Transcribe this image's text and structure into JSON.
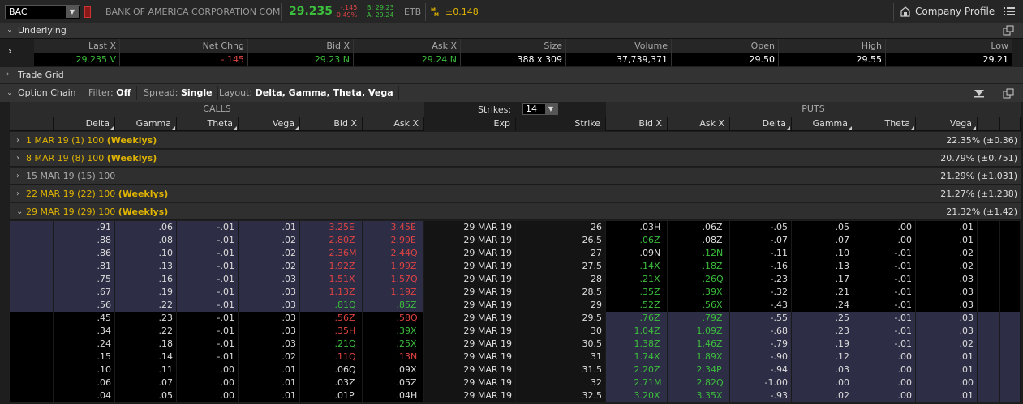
{
  "topbar": {
    "symbol": "BAC",
    "company": "BANK OF AMERICA CORPORATION COM",
    "last": "29.235",
    "net_change": "-.145",
    "pct_change": "-0.49%",
    "bid": "B: 29.23",
    "ask": "A: 29.24",
    "etb": "ETB",
    "mm_value": "±0.148",
    "company_profile": "Company Profile"
  },
  "underlying": {
    "title": "Underlying",
    "columns": [
      "Last X",
      "Net Chng",
      "Bid X",
      "Ask X",
      "Size",
      "Volume",
      "Open",
      "High",
      "Low"
    ],
    "values": [
      {
        "v": "29.235 V",
        "c": "green"
      },
      {
        "v": "-.145",
        "c": "red"
      },
      {
        "v": "29.23 N",
        "c": "green"
      },
      {
        "v": "29.24 N",
        "c": "green"
      },
      {
        "v": "388 x 309",
        "c": "white"
      },
      {
        "v": "37,739,371",
        "c": "white"
      },
      {
        "v": "29.50",
        "c": "white"
      },
      {
        "v": "29.55",
        "c": "white"
      },
      {
        "v": "29.21",
        "c": "white"
      }
    ]
  },
  "trade_grid": {
    "title": "Trade Grid"
  },
  "option_chain": {
    "title": "Option Chain",
    "filter_label": "Filter:",
    "filter_value": "Off",
    "spread_label": "Spread:",
    "spread_value": "Single",
    "layout_label": "Layout:",
    "layout_value": "Delta, Gamma, Theta, Vega",
    "calls_label": "CALLS",
    "puts_label": "PUTS",
    "strikes_label": "Strikes:",
    "strikes_value": "14",
    "call_headers": [
      "Delta",
      "Gamma",
      "Theta",
      "Vega",
      "Bid X",
      "Ask X"
    ],
    "mid_headers": [
      "Exp",
      "Strike"
    ],
    "put_headers": [
      "Bid X",
      "Ask X",
      "Delta",
      "Gamma",
      "Theta",
      "Vega"
    ]
  },
  "expirations": [
    {
      "date": "1 MAR 19",
      "days": "(1)",
      "mult": "100",
      "tag": "(Weeklys)",
      "iv": "22.35% (±0.36)",
      "color": "yellow",
      "expanded": false
    },
    {
      "date": "8 MAR 19",
      "days": "(8)",
      "mult": "100",
      "tag": "(Weeklys)",
      "iv": "20.79% (±0.751)",
      "color": "yellow",
      "expanded": false
    },
    {
      "date": "15 MAR 19",
      "days": "(15)",
      "mult": "100",
      "tag": "",
      "iv": "21.29% (±1.031)",
      "color": "grey",
      "expanded": false
    },
    {
      "date": "22 MAR 19",
      "days": "(22)",
      "mult": "100",
      "tag": "(Weeklys)",
      "iv": "21.27% (±1.238)",
      "color": "yellow",
      "expanded": false
    },
    {
      "date": "29 MAR 19",
      "days": "(29)",
      "mult": "100",
      "tag": "(Weeklys)",
      "iv": "21.32% (±1.42)",
      "color": "yellow",
      "expanded": true
    }
  ],
  "chain_rows": [
    {
      "cd": ".91",
      "cg": ".06",
      "ct": "-.01",
      "cv": ".01",
      "cb": "3.25",
      "cbx": "E",
      "ca": "3.45",
      "cax": "E",
      "exp": "29 MAR 19",
      "k": "26",
      "pb": ".03",
      "pbx": "H",
      "pa": ".06",
      "pax": "Z",
      "pd": "-.05",
      "pg": ".05",
      "pt": ".00",
      "pv": ".01",
      "itm": "call"
    },
    {
      "cd": ".88",
      "cg": ".08",
      "ct": "-.01",
      "cv": ".02",
      "cb": "2.80",
      "cbx": "Z",
      "ca": "2.99",
      "cax": "E",
      "exp": "29 MAR 19",
      "k": "26.5",
      "pb": ".06",
      "pbx": "Z",
      "pa": ".08",
      "pax": "Z",
      "pd": "-.07",
      "pg": ".07",
      "pt": ".00",
      "pv": ".01",
      "itm": "call"
    },
    {
      "cd": ".86",
      "cg": ".10",
      "ct": "-.01",
      "cv": ".02",
      "cb": "2.36",
      "cbx": "M",
      "ca": "2.44",
      "cax": "Q",
      "exp": "29 MAR 19",
      "k": "27",
      "pb": ".09",
      "pbx": "N",
      "pa": ".12",
      "pax": "N",
      "pd": "-.11",
      "pg": ".10",
      "pt": "-.01",
      "pv": ".02",
      "itm": "call"
    },
    {
      "cd": ".81",
      "cg": ".13",
      "ct": "-.01",
      "cv": ".02",
      "cb": "1.92",
      "cbx": "Z",
      "ca": "1.99",
      "cax": "Z",
      "exp": "29 MAR 19",
      "k": "27.5",
      "pb": ".14",
      "pbx": "X",
      "pa": ".18",
      "pax": "Z",
      "pd": "-.16",
      "pg": ".13",
      "pt": "-.01",
      "pv": ".02",
      "itm": "call"
    },
    {
      "cd": ".75",
      "cg": ".16",
      "ct": "-.01",
      "cv": ".03",
      "cb": "1.51",
      "cbx": "X",
      "ca": "1.57",
      "cax": "Q",
      "exp": "29 MAR 19",
      "k": "28",
      "pb": ".21",
      "pbx": "X",
      "pa": ".26",
      "pax": "Q",
      "pd": "-.23",
      "pg": ".17",
      "pt": "-.01",
      "pv": ".03",
      "itm": "call"
    },
    {
      "cd": ".67",
      "cg": ".19",
      "ct": "-.01",
      "cv": ".03",
      "cb": "1.13",
      "cbx": "Z",
      "ca": "1.19",
      "cax": "Z",
      "exp": "29 MAR 19",
      "k": "28.5",
      "pb": ".35",
      "pbx": "Z",
      "pa": ".39",
      "pax": "X",
      "pd": "-.32",
      "pg": ".21",
      "pt": "-.01",
      "pv": ".03",
      "itm": "call"
    },
    {
      "cd": ".56",
      "cg": ".22",
      "ct": "-.01",
      "cv": ".03",
      "cb": ".81",
      "cbx": "Q",
      "ca": ".85",
      "cax": "Z",
      "exp": "29 MAR 19",
      "k": "29",
      "pb": ".52",
      "pbx": "Z",
      "pa": ".56",
      "pax": "X",
      "pd": "-.43",
      "pg": ".24",
      "pt": "-.01",
      "pv": ".03",
      "itm": "call"
    },
    {
      "cd": ".45",
      "cg": ".23",
      "ct": "-.01",
      "cv": ".03",
      "cb": ".56",
      "cbx": "Z",
      "ca": ".58",
      "cax": "Q",
      "exp": "29 MAR 19",
      "k": "29.5",
      "pb": ".76",
      "pbx": "Z",
      "pa": ".79",
      "pax": "Z",
      "pd": "-.55",
      "pg": ".25",
      "pt": "-.01",
      "pv": ".03",
      "itm": "put"
    },
    {
      "cd": ".34",
      "cg": ".22",
      "ct": "-.01",
      "cv": ".03",
      "cb": ".35",
      "cbx": "H",
      "ca": ".39",
      "cax": "X",
      "exp": "29 MAR 19",
      "k": "30",
      "pb": "1.04",
      "pbx": "Z",
      "pa": "1.09",
      "pax": "Z",
      "pd": "-.68",
      "pg": ".23",
      "pt": "-.01",
      "pv": ".03",
      "itm": "put"
    },
    {
      "cd": ".24",
      "cg": ".18",
      "ct": "-.01",
      "cv": ".03",
      "cb": ".21",
      "cbx": "Q",
      "ca": ".25",
      "cax": "X",
      "exp": "29 MAR 19",
      "k": "30.5",
      "pb": "1.38",
      "pbx": "Z",
      "pa": "1.46",
      "pax": "Z",
      "pd": "-.79",
      "pg": ".19",
      "pt": "-.01",
      "pv": ".02",
      "itm": "put"
    },
    {
      "cd": ".15",
      "cg": ".14",
      "ct": "-.01",
      "cv": ".02",
      "cb": ".11",
      "cbx": "Q",
      "ca": ".13",
      "cax": "N",
      "exp": "29 MAR 19",
      "k": "31",
      "pb": "1.74",
      "pbx": "X",
      "pa": "1.89",
      "pax": "X",
      "pd": "-.90",
      "pg": ".12",
      "pt": ".00",
      "pv": ".01",
      "itm": "put"
    },
    {
      "cd": ".10",
      "cg": ".11",
      "ct": ".00",
      "cv": ".01",
      "cb": ".06",
      "cbx": "Q",
      "ca": ".09",
      "cax": "X",
      "exp": "29 MAR 19",
      "k": "31.5",
      "pb": "2.20",
      "pbx": "Z",
      "pa": "2.34",
      "pax": "P",
      "pd": "-.94",
      "pg": ".03",
      "pt": ".00",
      "pv": ".01",
      "itm": "put"
    },
    {
      "cd": ".06",
      "cg": ".07",
      "ct": ".00",
      "cv": ".01",
      "cb": ".03",
      "cbx": "Z",
      "ca": ".05",
      "cax": "Z",
      "exp": "29 MAR 19",
      "k": "32",
      "pb": "2.71",
      "pbx": "M",
      "pa": "2.82",
      "pax": "Q",
      "pd": "-1.00",
      "pg": ".00",
      "pt": ".00",
      "pv": ".00",
      "itm": "put"
    },
    {
      "cd": ".04",
      "cg": ".05",
      "ct": ".00",
      "cv": ".01",
      "cb": ".01",
      "cbx": "P",
      "ca": ".04",
      "cax": "H",
      "exp": "29 MAR 19",
      "k": "32.5",
      "pb": "3.20",
      "pbx": "X",
      "pa": "3.35",
      "pax": "X",
      "pd": "-.93",
      "pg": ".02",
      "pt": ".00",
      "pv": ".01",
      "itm": "put"
    }
  ],
  "colors": {
    "green": "#3cbf3c",
    "red": "#e04343",
    "yellow": "#e0b400",
    "itm_bg": "#2d2d45"
  }
}
